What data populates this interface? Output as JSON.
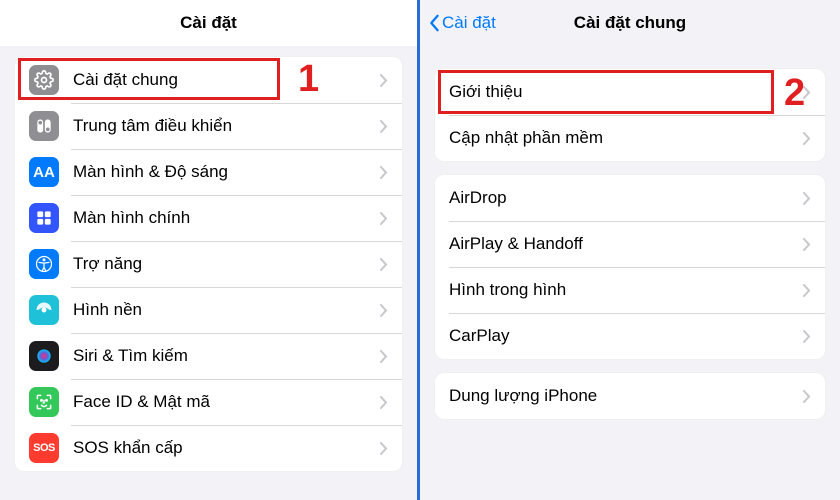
{
  "left": {
    "title": "Cài đặt",
    "items": [
      {
        "key": "general",
        "label": "Cài đặt chung",
        "icon": "gear"
      },
      {
        "key": "control",
        "label": "Trung tâm điều khiển",
        "icon": "control-center"
      },
      {
        "key": "display",
        "label": "Màn hình & Độ sáng",
        "icon": "display"
      },
      {
        "key": "home",
        "label": "Màn hình chính",
        "icon": "home-screen"
      },
      {
        "key": "access",
        "label": "Trợ năng",
        "icon": "accessibility"
      },
      {
        "key": "wall",
        "label": "Hình nền",
        "icon": "wallpaper"
      },
      {
        "key": "siri",
        "label": "Siri & Tìm kiếm",
        "icon": "siri"
      },
      {
        "key": "face",
        "label": "Face ID & Mật mã",
        "icon": "face-id"
      },
      {
        "key": "sos",
        "label": "SOS khẩn cấp",
        "icon": "sos",
        "badge": "SOS"
      }
    ],
    "annotation": "1"
  },
  "right": {
    "back_label": "Cài đặt",
    "title": "Cài đặt chung",
    "group1": [
      {
        "key": "about",
        "label": "Giới thiệu"
      },
      {
        "key": "update",
        "label": "Cập nhật phần mềm"
      }
    ],
    "group2": [
      {
        "key": "airdrop",
        "label": "AirDrop"
      },
      {
        "key": "airplay",
        "label": "AirPlay & Handoff"
      },
      {
        "key": "pip",
        "label": "Hình trong hình"
      },
      {
        "key": "carplay",
        "label": "CarPlay"
      }
    ],
    "group3": [
      {
        "key": "storage",
        "label": "Dung lượng iPhone"
      }
    ],
    "annotation": "2"
  }
}
